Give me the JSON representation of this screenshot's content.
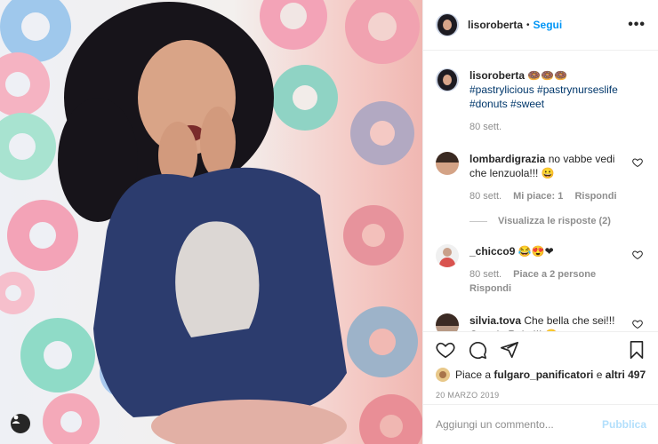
{
  "post": {
    "username": "lisoroberta",
    "follow_label": "Segui",
    "separator": "•",
    "more_label": "•••"
  },
  "caption": {
    "username": "lisoroberta",
    "emoji": "🍩🍩🍩",
    "hashtags": [
      "#pastrylicious",
      "#pastrynurseslife",
      "#donuts",
      "#sweet"
    ],
    "age": "80 sett."
  },
  "comments": [
    {
      "username": "lombardigrazia",
      "text": "no vabbe vedi che lenzuola!!! 😀",
      "age": "80 sett.",
      "likes": "Mi piace: 1",
      "reply_label": "Rispondi",
      "view_replies": "Visualizza le risposte (2)"
    },
    {
      "username": "_chicco9",
      "text": "😂😍❤",
      "age": "80 sett.",
      "likes": "Piace a 2 persone",
      "reply_label": "Rispondi"
    },
    {
      "username": "silvia.tova",
      "text": "Che bella che sei!!! Grande Roby!!! 😍"
    }
  ],
  "likes": {
    "prefix": "Piace a",
    "user": "fulgaro_panificatori",
    "conj": "e",
    "others": "altri 497"
  },
  "date": "20 MARZO 2019",
  "add_comment": {
    "placeholder": "Aggiungi un commento...",
    "publish_label": "Pubblica"
  },
  "colors": {
    "link_blue": "#0095f6",
    "hashtag": "#00376b",
    "muted": "#8e8e8e",
    "publish_disabled": "#b2dffc"
  },
  "icons": [
    "heart-icon",
    "comment-icon",
    "share-icon",
    "bookmark-icon",
    "user-tag-icon",
    "more-icon"
  ]
}
